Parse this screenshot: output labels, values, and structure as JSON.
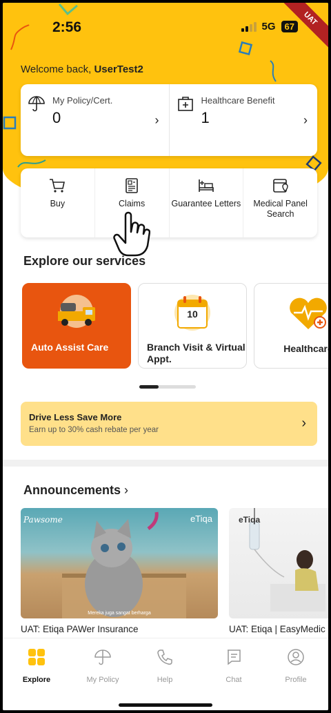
{
  "status": {
    "time": "2:56",
    "network": "5G",
    "battery": "67",
    "ribbon": "UAT"
  },
  "welcome": {
    "prefix": "Welcome back, ",
    "user": "UserTest2"
  },
  "policy_card": {
    "policy_label": "My Policy/Cert.",
    "policy_count": "0",
    "health_label": "Healthcare Benefit",
    "health_count": "1"
  },
  "actions": [
    {
      "label": "Buy",
      "icon": "cart-icon"
    },
    {
      "label": "Claims",
      "icon": "claims-form-icon"
    },
    {
      "label": "Guarantee Letters",
      "icon": "hospital-bed-icon"
    },
    {
      "label": "Medical Panel Search",
      "icon": "clinic-location-icon"
    }
  ],
  "services": {
    "title": "Explore our services",
    "items": [
      {
        "label": "Auto Assist Care",
        "icon": "tow-truck-icon"
      },
      {
        "label": "Branch Visit & Virtual Appt.",
        "icon": "calendar-icon",
        "calendar_day": "10"
      },
      {
        "label": "Healthcare",
        "icon": "heart-icon"
      }
    ]
  },
  "promo": {
    "title": "Drive Less Save More",
    "subtitle": "Earn up to 30% cash rebate per year"
  },
  "announcements": {
    "title": "Announcements",
    "items": [
      {
        "caption": "UAT: Etiqa PAWer Insurance",
        "subtitle_text": "Mereka juga sangat berharga",
        "brand": "eTiqa",
        "corner": "Pawsome"
      },
      {
        "caption": "UAT: Etiqa | EasyMedic",
        "brand": "eTiqa"
      }
    ]
  },
  "nav": [
    {
      "label": "Explore",
      "icon": "grid-icon",
      "active": true
    },
    {
      "label": "My Policy",
      "icon": "umbrella-icon"
    },
    {
      "label": "Help",
      "icon": "phone-icon"
    },
    {
      "label": "Chat",
      "icon": "chat-icon"
    },
    {
      "label": "Profile",
      "icon": "profile-icon"
    }
  ],
  "colors": {
    "brand_yellow": "#FFC20E",
    "accent_orange": "#E8550F",
    "promo_bg": "#FFE08A"
  }
}
